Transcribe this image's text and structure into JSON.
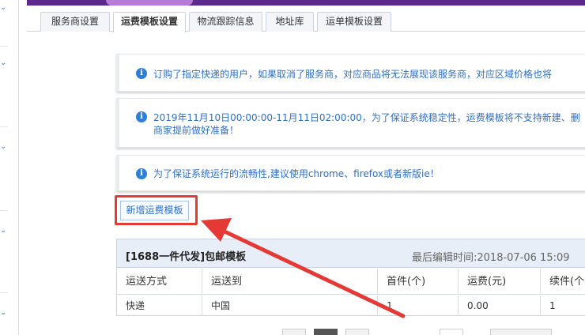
{
  "tabs": [
    {
      "label": "服务商设置",
      "active": false
    },
    {
      "label": "运费模板设置",
      "active": true
    },
    {
      "label": "物流跟踪信息",
      "active": false
    },
    {
      "label": "地址库",
      "active": false
    },
    {
      "label": "运单模板设置",
      "active": false
    }
  ],
  "notices": [
    "订购了指定快递的用户，如果取消了服务商，对应商品将无法展现该服务商，对应区域价格也将",
    "2019年11月10日00:00:00-11月11日02:00:00，为了保证系统稳定性，运费模板将不支持新建、删",
    "商家提前做好准备！",
    "为了保证系统运行的流畅性,建议使用chrome、firefox或者新版ie！"
  ],
  "add_template_button": "新增运费模板",
  "template": {
    "name": "[1688一件代发]包邮模板",
    "last_edit": "最后编辑时间:2018-07-06 15:09",
    "columns": [
      "运送方式",
      "运送到",
      "首件(个)",
      "运费(元)",
      "续件(个"
    ],
    "rows": [
      [
        "快递",
        "中国",
        "1",
        "0.00",
        "1"
      ]
    ]
  },
  "colors": {
    "accent": "#2f6fc4",
    "highlight": "#e53935",
    "banner": "#5b2a8c"
  },
  "icons": {
    "notice": "info-icon",
    "sidebar": "chevron-down-icon"
  }
}
